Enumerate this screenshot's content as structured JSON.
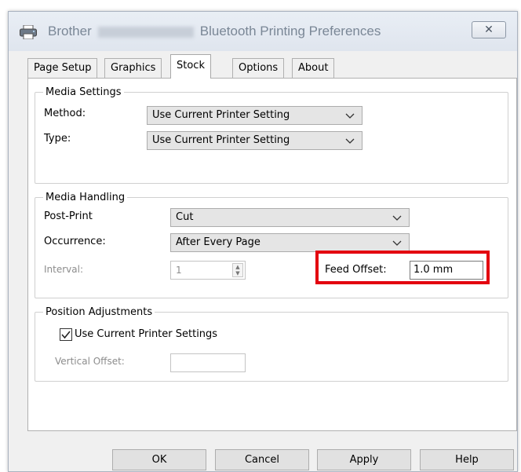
{
  "window": {
    "title_prefix": "Brother",
    "title_suffix": "Bluetooth Printing Preferences",
    "close_label": "✕"
  },
  "tabs": [
    {
      "label": "Page Setup"
    },
    {
      "label": "Graphics"
    },
    {
      "label": "Stock"
    },
    {
      "label": "Options"
    },
    {
      "label": "About"
    }
  ],
  "active_tab": "Stock",
  "media_settings": {
    "legend": "Media Settings",
    "method_label": "Method:",
    "method_value": "Use Current Printer Setting",
    "type_label": "Type:",
    "type_value": "Use Current Printer Setting"
  },
  "media_handling": {
    "legend": "Media Handling",
    "post_print_label": "Post-Print",
    "post_print_value": "Cut",
    "occurrence_label": "Occurrence:",
    "occurrence_value": "After Every Page",
    "interval_label": "Interval:",
    "interval_value": "1",
    "feed_offset_label": "Feed Offset:",
    "feed_offset_value": "1.0 mm"
  },
  "position_adjustments": {
    "legend": "Position Adjustments",
    "use_current_label": "Use Current Printer Settings",
    "use_current_checked": true,
    "vertical_offset_label": "Vertical Offset:",
    "vertical_offset_value": ""
  },
  "buttons": {
    "ok": "OK",
    "cancel": "Cancel",
    "apply": "Apply",
    "help": "Help"
  },
  "colors": {
    "highlight": "#e3000f",
    "title_text": "#7a8796"
  }
}
